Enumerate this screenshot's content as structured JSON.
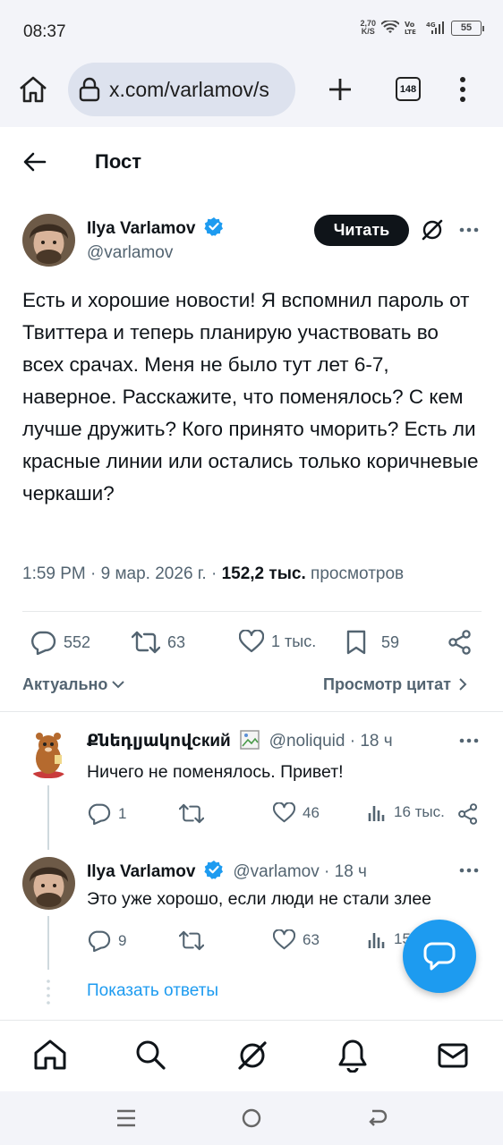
{
  "status_bar": {
    "time": "08:37",
    "net_speed_value": "2,70",
    "net_speed_unit": "K/S",
    "battery": "55"
  },
  "browser": {
    "url": "x.com/varlamov/s",
    "tab_count": "148"
  },
  "header": {
    "title": "Пост"
  },
  "post": {
    "author_name": "Ilya Varlamov",
    "author_handle": "@varlamov",
    "follow_label": "Читать",
    "text": "Есть и хорошие новости! Я вспомнил пароль от Твиттера и теперь планирую участвовать во всех срачах. Меня не было тут лет 6-7, наверное. Расскажите, что поменялось? С кем лучше дружить? Кого принято чморить? Есть ли красные линии или остались только коричневые черкаши?",
    "time": "1:59 PM · 9 мар. 2026 г. · ",
    "views_count": "152,2 тыс.",
    "views_label": " просмотров",
    "stats": {
      "replies": "552",
      "reposts": "63",
      "likes": "1 тыс.",
      "bookmarks": "59"
    }
  },
  "sort": {
    "label": "Актуально",
    "quotes_label": "Просмотр цитат"
  },
  "replies": [
    {
      "name": "Քնեդլյակովский",
      "handle": "@noliquid",
      "time": " · 18 ч",
      "text": "Ничего не поменялось. Привет!",
      "stats": {
        "replies": "1",
        "reposts": "",
        "likes": "46",
        "views": "16 тыс."
      }
    },
    {
      "name": "Ilya Varlamov",
      "handle": "@varlamov",
      "time": " · 18 ч",
      "text": "Это уже хорошо, если люди не стали злее",
      "stats": {
        "replies": "9",
        "reposts": "",
        "likes": "63",
        "views": "15"
      }
    }
  ],
  "show_replies_label": "Показать ответы",
  "colors": {
    "accent": "#1d9bf0",
    "text": "#0f1419",
    "secondary": "#536471"
  }
}
